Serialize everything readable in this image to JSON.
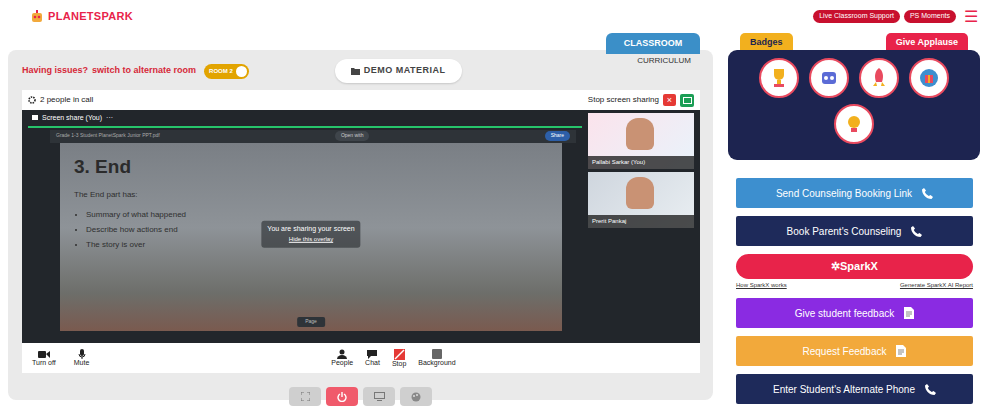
{
  "header": {
    "logo": "PLANETSPARK",
    "links": [
      "Live Classroom Support",
      "PS Moments"
    ],
    "menu": "☰"
  },
  "classroom": {
    "issue": "Having issues?",
    "switch_link": "switch to alternate room",
    "room_toggle": {
      "label": "ROOM 2",
      "on": true
    },
    "demo_material": "DEMO MATERIAL",
    "tabs": [
      {
        "label": "CLASSROOM",
        "selected": true
      },
      {
        "label": "CURRICULUM",
        "selected": false
      }
    ]
  },
  "call": {
    "people_count": "2 people in call",
    "stop_sharing": "Stop screen sharing",
    "close": "×",
    "share_tab": "Screen share (You)",
    "share_more": "···",
    "viewer": {
      "file": "Grade 1-3 Student PlanetSpark Junior PPT.pdf",
      "open_with": "Open with",
      "share": "Share",
      "page_label": "Page"
    },
    "slide": {
      "title": "3. End",
      "intro": "The End part has:",
      "bullets": [
        "Summary of what happened",
        "Describe how actions end",
        "The story is over"
      ]
    },
    "overlay": {
      "message": "You are sharing your screen",
      "hide": "Hide this overlay"
    },
    "participants": [
      {
        "name": "Pallabi Sarkar (You)"
      },
      {
        "name": "Prerit Pankaj"
      }
    ],
    "controls": [
      {
        "label": "Turn off",
        "kind": "camera"
      },
      {
        "label": "Mute",
        "kind": "mic"
      },
      {
        "label": "People",
        "kind": "people"
      },
      {
        "label": "Chat",
        "kind": "chat"
      },
      {
        "label": "Stop",
        "kind": "stop"
      },
      {
        "label": "Background",
        "kind": "background"
      }
    ]
  },
  "toolbar": [
    {
      "kind": "expand"
    },
    {
      "kind": "power"
    },
    {
      "kind": "screen"
    },
    {
      "kind": "palette"
    }
  ],
  "side": {
    "tabs": [
      {
        "label": "Badges",
        "color": "#f2b01e"
      },
      {
        "label": "Give Applause",
        "color": "#e8234a"
      }
    ],
    "badges": [
      {
        "kind": "trophy"
      },
      {
        "kind": "robot"
      },
      {
        "kind": "rocket"
      },
      {
        "kind": "gift"
      },
      {
        "kind": "bulb"
      }
    ],
    "actions": [
      {
        "kind": "button",
        "label": "Send Counseling Booking Link",
        "icon": "phone",
        "color": "#3d8fcf"
      },
      {
        "kind": "button",
        "label": "Book Parent's Counseling",
        "icon": "phone",
        "color": "#1e2a5a"
      },
      {
        "kind": "sparkx",
        "label": "✲SparkX",
        "links": [
          "How SparkX works",
          "Generate SparkX AI Report"
        ],
        "color": "#e8234a"
      },
      {
        "kind": "button",
        "label": "Give student feedback",
        "icon": "doc",
        "color": "#8a2be2"
      },
      {
        "kind": "button",
        "label": "Request Feedback",
        "icon": "doc",
        "color": "#f2a93b"
      },
      {
        "kind": "button",
        "label": "Enter Student's Alternate Phone",
        "icon": "phone",
        "color": "#1e2a5a"
      }
    ]
  }
}
